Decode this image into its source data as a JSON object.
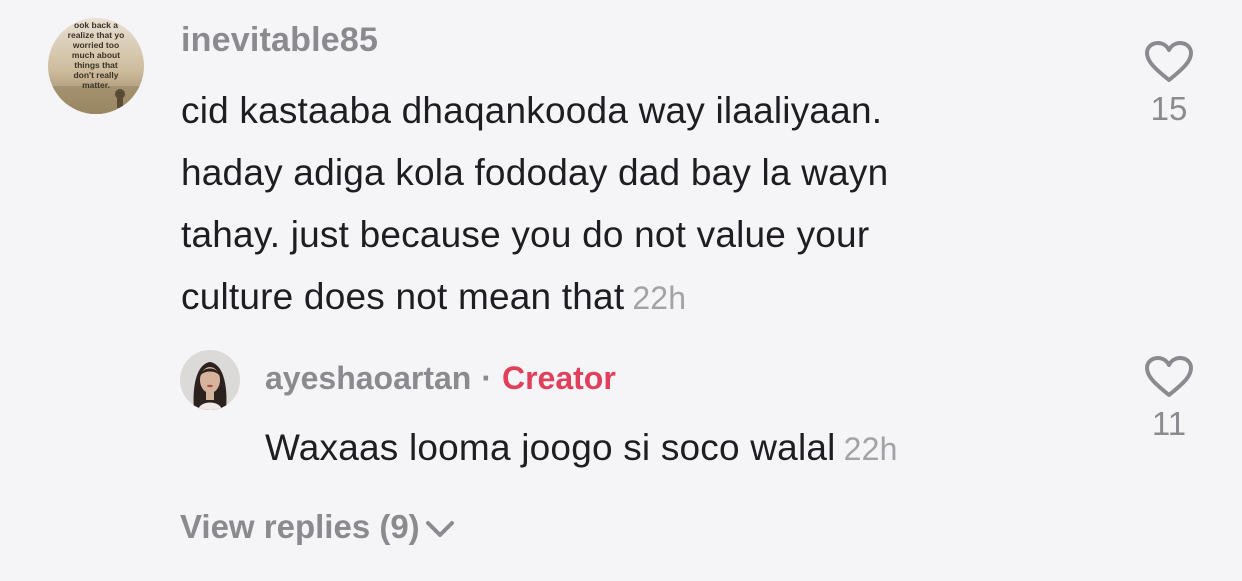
{
  "comment": {
    "username": "inevitable85",
    "avatar_text": [
      "ook back a",
      "realize that yo",
      "worried too",
      "much about",
      "things that",
      "don't really",
      "matter."
    ],
    "text_lines": [
      "cid kastaaba dhaqankooda way ilaaliyaan.",
      "haday adiga kola fododay dad bay la wayn",
      "tahay. just because you do not value your",
      "culture does not mean that"
    ],
    "time": "22h",
    "like_icon": "heart-outline-icon",
    "like_count": "15"
  },
  "reply": {
    "username": "ayeshaoartan",
    "separator": "·",
    "badge": "Creator",
    "badge_color": "#e0405c",
    "text": "Waxaas looma joogo si soco walal",
    "time": "22h",
    "like_icon": "heart-outline-icon",
    "like_count": "11"
  },
  "view_replies": {
    "label": "View replies (9)",
    "icon": "chevron-down-icon"
  }
}
